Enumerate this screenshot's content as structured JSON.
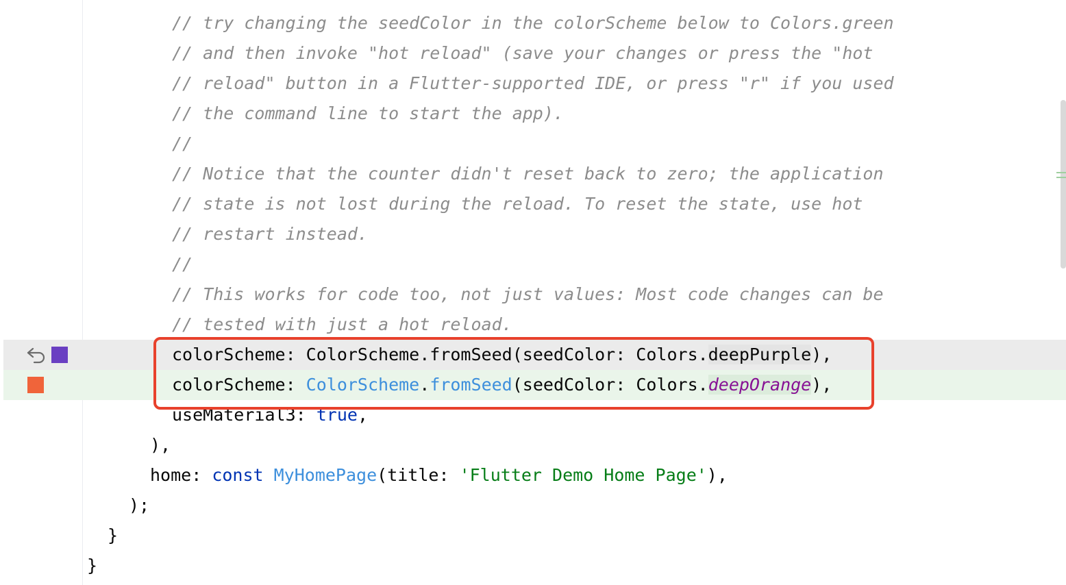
{
  "editor": {
    "comments": [
      "// try changing the seedColor in the colorScheme below to Colors.green",
      "// and then invoke \"hot reload\" (save your changes or press the \"hot",
      "// reload\" button in a Flutter-supported IDE, or press \"r\" if you used",
      "// the command line to start the app).",
      "//",
      "// Notice that the counter didn't reset back to zero; the application",
      "// state is not lost during the reload. To reset the state, use hot",
      "// restart instead.",
      "//",
      "// This works for code too, not just values: Most code changes can be",
      "// tested with just a hot reload."
    ],
    "old_line": {
      "prefix": "colorScheme: ColorScheme.fromSeed(seedColor: Colors.",
      "changed": "deepPurple",
      "suffix": "),"
    },
    "new_line": {
      "lead": "colorScheme: ",
      "cls": "ColorScheme",
      "dot": ".",
      "fn": "fromSeed",
      "mid": "(seedColor: Colors.",
      "changed": "deepOrange",
      "suffix": "),"
    },
    "use_material": {
      "text": "useMaterial3: ",
      "value": "true",
      "end": ","
    },
    "close_paren": "),",
    "home_line": {
      "prop": "home: ",
      "kw": "const ",
      "cls": "MyHomePage",
      "open": "(title: ",
      "str": "'Flutter Demo Home Page'",
      "end": "),"
    },
    "close_semicolon": ");",
    "close_brace_inner": "}",
    "close_brace_outer": "}"
  },
  "gutter": {
    "old_color": "#6a3fc2",
    "new_color": "#f0643a",
    "revert_icon": "undo-arrow-icon"
  },
  "colors": {
    "highlight_border": "#e8412c"
  }
}
